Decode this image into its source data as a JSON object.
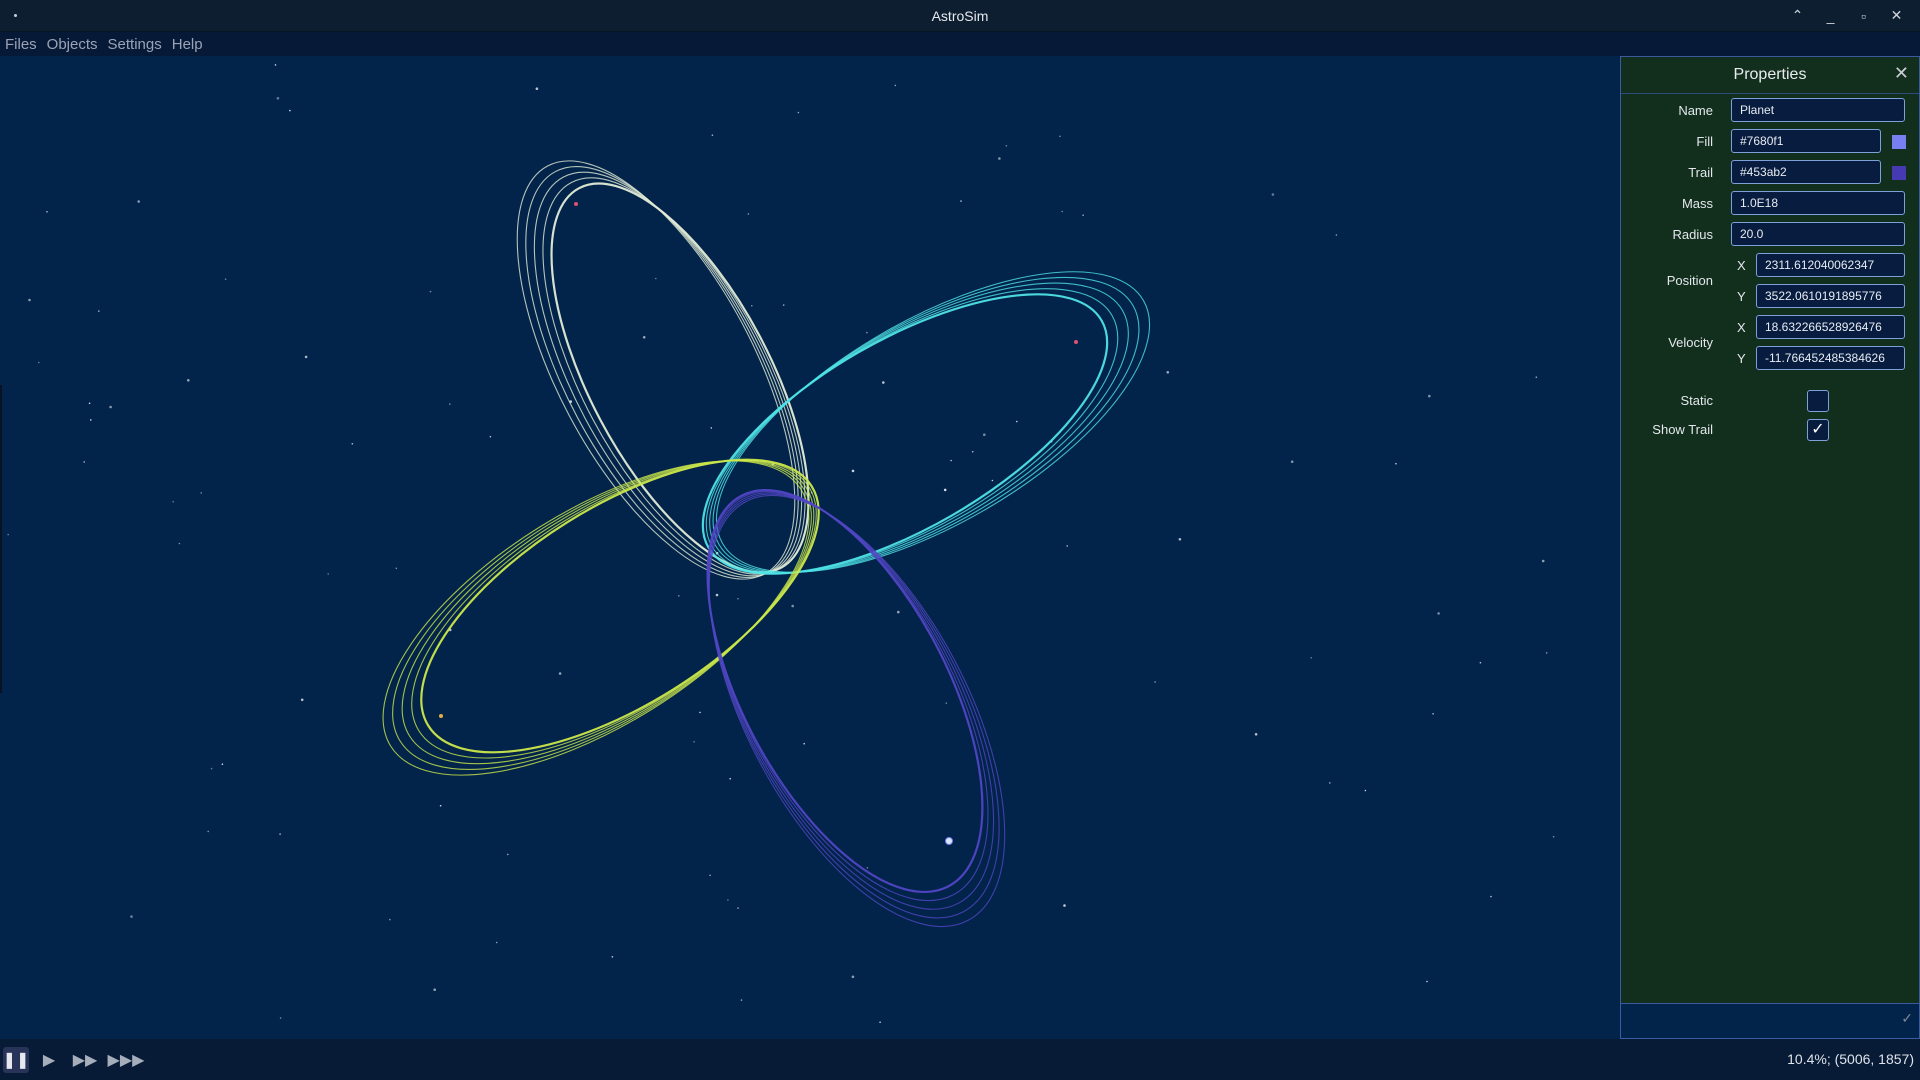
{
  "window": {
    "title": "AstroSim"
  },
  "menu": [
    "Files",
    "Objects",
    "Settings",
    "Help"
  ],
  "panel": {
    "title": "Properties",
    "name_label": "Name",
    "name": "Planet",
    "fill_label": "Fill",
    "fill": "#7680f1",
    "trail_label": "Trail",
    "trail": "#453ab2",
    "mass_label": "Mass",
    "mass": "1.0E18",
    "radius_label": "Radius",
    "radius": "20.0",
    "position_label": "Position",
    "position_x": "2311.612040062347",
    "position_y": "3522.0610191895776",
    "velocity_label": "Velocity",
    "velocity_x": "18.632266528926476",
    "velocity_y": "-11.766452485384626",
    "x_label": "X",
    "y_label": "Y",
    "static_label": "Static",
    "static": false,
    "show_trail_label": "Show Trail",
    "show_trail": true,
    "check_mark": "✓"
  },
  "status": {
    "zoom_and_coords": "10.4%; (5006, 1857)"
  },
  "controls": [
    "pause",
    "play",
    "fast-forward",
    "fastest-forward"
  ],
  "orbits": [
    {
      "name": "white-orbit",
      "color": "#e2ecd6"
    },
    {
      "name": "cyan-orbit",
      "color": "#4fe4e6"
    },
    {
      "name": "yellow-green-orbit",
      "color": "#cce84a"
    },
    {
      "name": "purple-orbit",
      "color": "#5146c4"
    }
  ]
}
